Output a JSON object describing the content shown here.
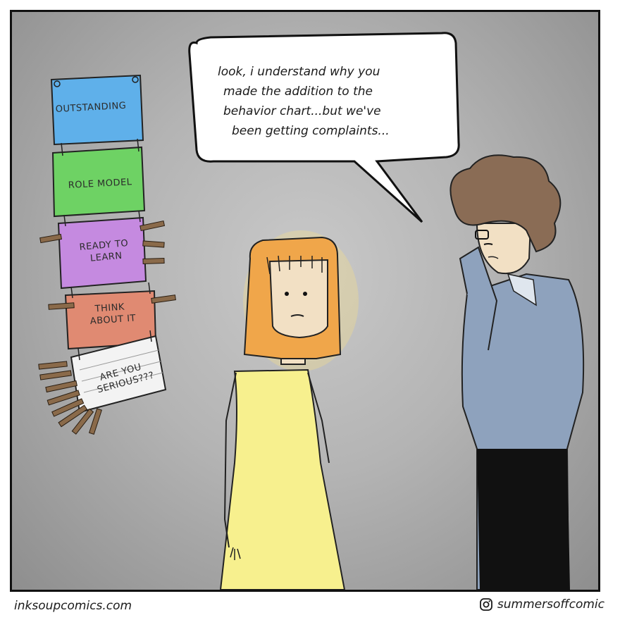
{
  "speech": {
    "lines": [
      "look, i understand why you",
      "made the addition to the",
      "behavior chart...but we've",
      "been getting complaints..."
    ]
  },
  "behavior_chart": {
    "levels": [
      {
        "label_lines": [
          "OUTSTANDING"
        ],
        "color": "#5fb0ea"
      },
      {
        "label_lines": [
          "ROLE MODEL"
        ],
        "color": "#6ed264"
      },
      {
        "label_lines": [
          "READY TO",
          "LEARN"
        ],
        "color": "#c58ae0"
      },
      {
        "label_lines": [
          "THINK",
          "ABOUT IT"
        ],
        "color": "#e08a72"
      },
      {
        "label_lines": [
          "ARE YOU",
          "SERIOUS???"
        ],
        "color": "#f3f3f3"
      }
    ]
  },
  "footer": {
    "site": "inksoupcomics.com",
    "instagram_handle": "summersoffcomic"
  },
  "colors": {
    "background": "#b9b9b9",
    "girl_hair": "#f0a64a",
    "girl_dress": "#f7f08e",
    "teacher_shirt": "#8ea2bd",
    "teacher_hair": "#8a6c55",
    "clothespin": "#8a6a4a"
  }
}
